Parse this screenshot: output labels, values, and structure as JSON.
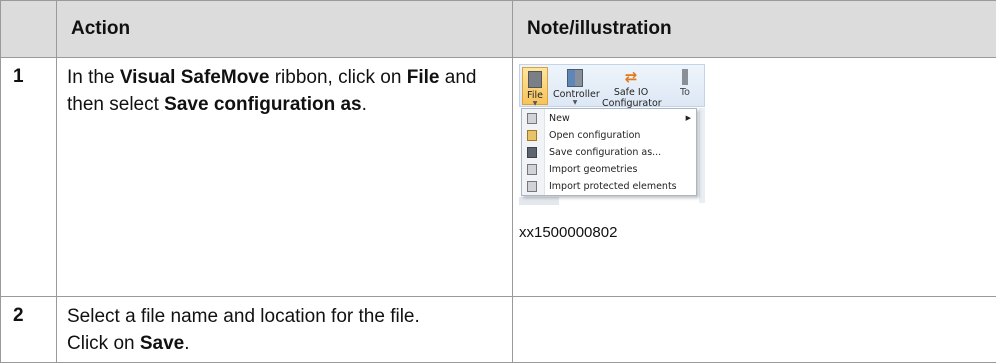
{
  "headers": {
    "num": "",
    "action": "Action",
    "note": "Note/illustration"
  },
  "rows": [
    {
      "num": "1",
      "action": {
        "t1": "In the ",
        "b1": "Visual SafeMove",
        "t2": " ribbon, click on ",
        "b2": "File",
        "t3": " and then select ",
        "b3": "Save configuration as",
        "t4": "."
      },
      "illustration": {
        "ribbon_buttons": {
          "file": "File",
          "controller": "Controller",
          "safeio_line1": "Safe IO",
          "safeio_line2": "Configurator",
          "truncated": "To"
        },
        "menu_items": [
          {
            "label": "New",
            "icon": "new-doc-icon",
            "has_submenu": true
          },
          {
            "label": "Open configuration",
            "icon": "open-folder-icon"
          },
          {
            "label": "Save configuration as...",
            "icon": "save-disk-icon"
          },
          {
            "label": "Import geometries",
            "icon": "import-doc-icon"
          },
          {
            "label": "Import protected elements",
            "icon": "import-doc-icon"
          }
        ],
        "figure_id": "xx1500000802"
      }
    },
    {
      "num": "2",
      "action": {
        "line1": "Select a file name and location for the file.",
        "t1": "Click on ",
        "b1": "Save",
        "t2": "."
      },
      "note": ""
    }
  ]
}
